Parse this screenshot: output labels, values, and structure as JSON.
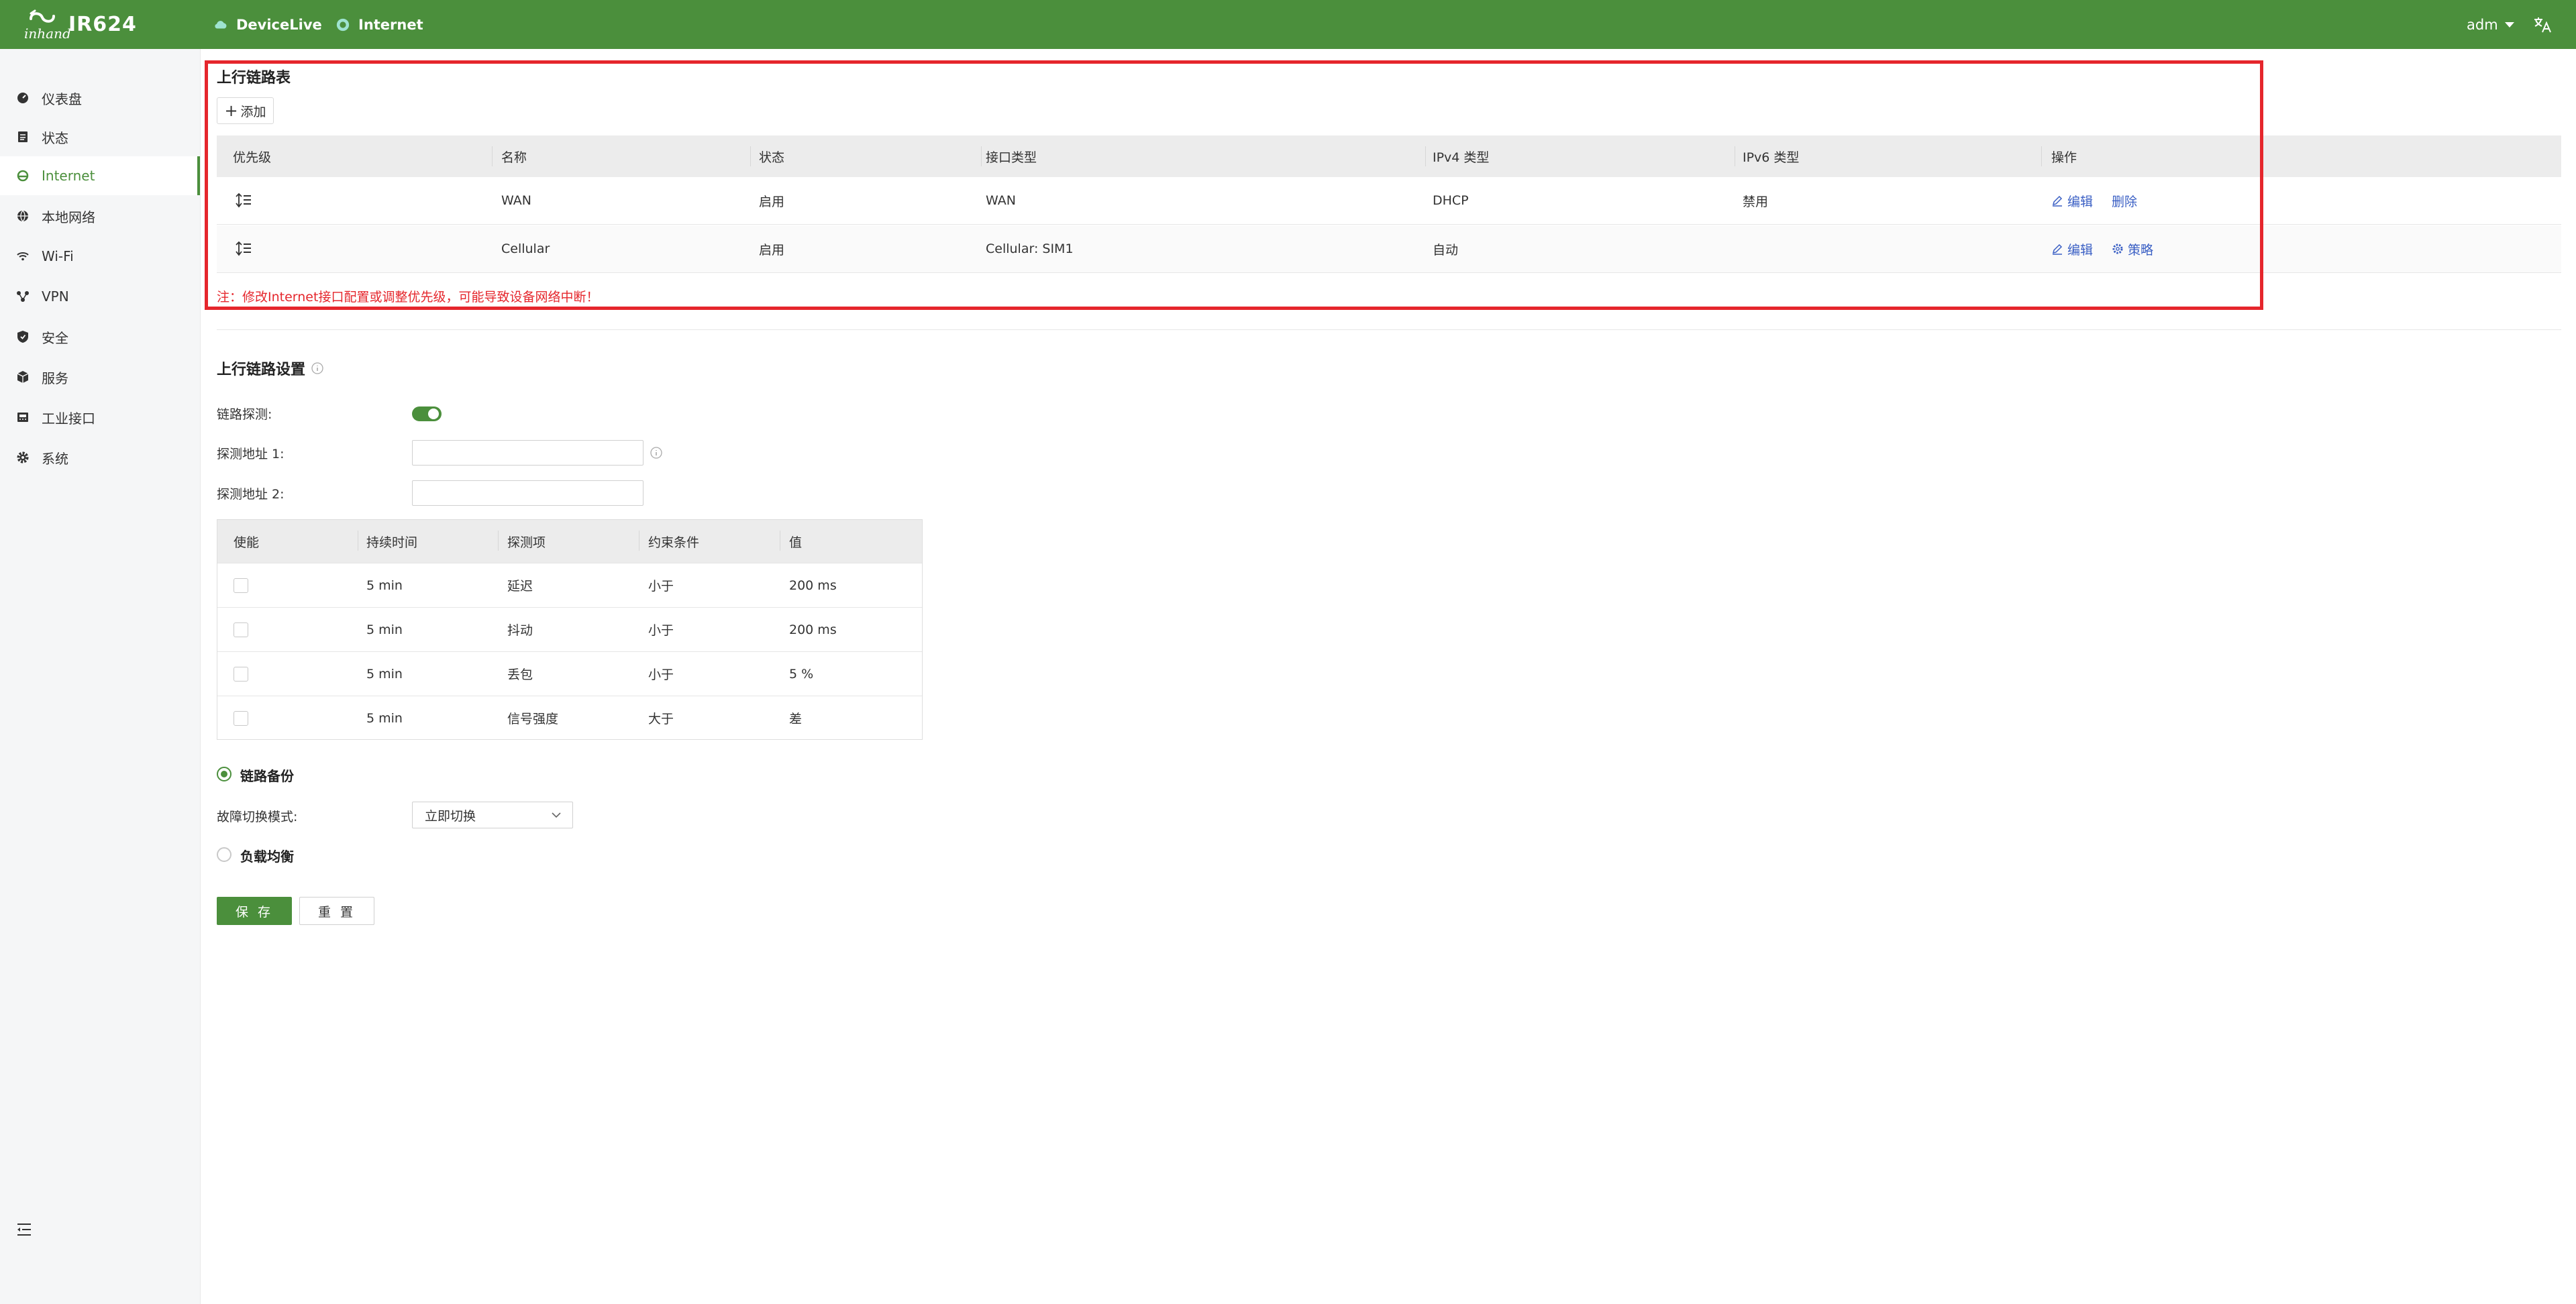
{
  "header": {
    "brand_word": "inhand",
    "product": "IR624",
    "nav": [
      {
        "label": "DeviceLive",
        "icon": "cloud-icon"
      },
      {
        "label": "Internet",
        "icon": "globe-dot-icon"
      }
    ],
    "user": "adm",
    "lang_icon": "translate-icon"
  },
  "sidebar": {
    "items": [
      {
        "label": "仪表盘",
        "icon": "dashboard-icon"
      },
      {
        "label": "状态",
        "icon": "status-icon"
      },
      {
        "label": "Internet",
        "icon": "internet-icon",
        "active": true
      },
      {
        "label": "本地网络",
        "icon": "local-network-icon"
      },
      {
        "label": "Wi-Fi",
        "icon": "wifi-icon"
      },
      {
        "label": "VPN",
        "icon": "vpn-icon"
      },
      {
        "label": "安全",
        "icon": "shield-icon"
      },
      {
        "label": "服务",
        "icon": "services-icon"
      },
      {
        "label": "工业接口",
        "icon": "industrial-icon"
      },
      {
        "label": "系统",
        "icon": "gear-icon"
      }
    ]
  },
  "uplink_table": {
    "title": "上行链路表",
    "add_label": "添加",
    "columns": [
      "优先级",
      "名称",
      "状态",
      "接口类型",
      "IPv4 类型",
      "IPv6 类型",
      "操作"
    ],
    "rows": [
      {
        "name": "WAN",
        "status": "启用",
        "iface": "WAN",
        "ipv4": "DHCP",
        "ipv6": "禁用",
        "actions": [
          "编辑",
          "删除"
        ]
      },
      {
        "name": "Cellular",
        "status": "启用",
        "iface": "Cellular: SIM1",
        "ipv4": "自动",
        "ipv6": "",
        "actions": [
          "编辑",
          "策略"
        ]
      }
    ],
    "note": "注：修改Internet接口配置或调整优先级，可能导致设备网络中断！"
  },
  "uplink_settings": {
    "title": "上行链路设置",
    "detect_label": "链路探测:",
    "detect_enabled": true,
    "addr1_label": "探测地址 1:",
    "addr1_value": "",
    "addr2_label": "探测地址 2:",
    "addr2_value": "",
    "probe_columns": [
      "使能",
      "持续时间",
      "探测项",
      "约束条件",
      "值"
    ],
    "probe_rows": [
      {
        "enabled": false,
        "duration": "5 min",
        "item": "延迟",
        "cond": "小于",
        "value": "200 ms"
      },
      {
        "enabled": false,
        "duration": "5 min",
        "item": "抖动",
        "cond": "小于",
        "value": "200 ms"
      },
      {
        "enabled": false,
        "duration": "5 min",
        "item": "丢包",
        "cond": "小于",
        "value": "5 %"
      },
      {
        "enabled": false,
        "duration": "5 min",
        "item": "信号强度",
        "cond": "大于",
        "value": "差"
      }
    ],
    "backup_label": "链路备份",
    "backup_selected": true,
    "failover_label": "故障切换模式:",
    "failover_value": "立即切换",
    "loadbalance_label": "负载均衡",
    "save_label": "保 存",
    "reset_label": "重 置"
  },
  "colors": {
    "brand": "#4b8f3c",
    "link": "#3a5fc4",
    "warn": "#e5262c"
  }
}
